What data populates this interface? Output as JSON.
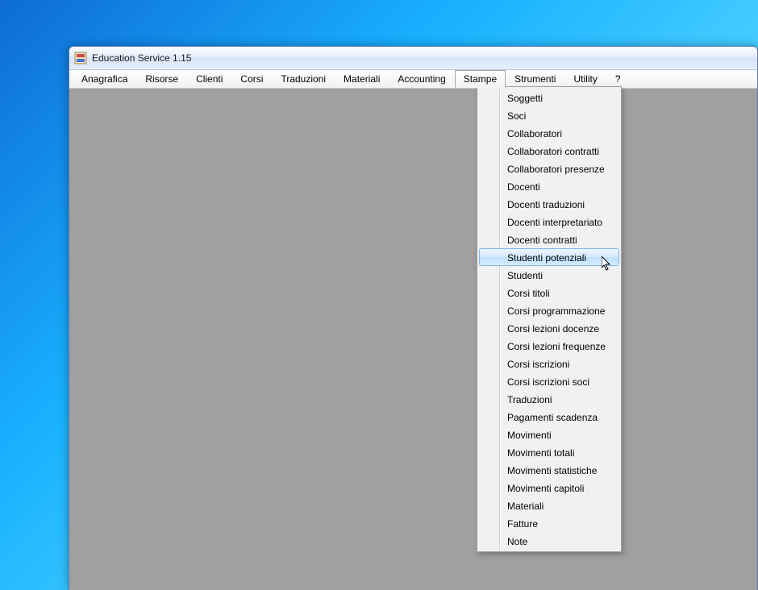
{
  "window": {
    "title": "Education Service 1.15"
  },
  "menubar": {
    "items": [
      {
        "label": "Anagrafica"
      },
      {
        "label": "Risorse"
      },
      {
        "label": "Clienti"
      },
      {
        "label": "Corsi"
      },
      {
        "label": "Traduzioni"
      },
      {
        "label": "Materiali"
      },
      {
        "label": "Accounting"
      },
      {
        "label": "Stampe"
      },
      {
        "label": "Strumenti"
      },
      {
        "label": "Utility"
      },
      {
        "label": "?"
      }
    ],
    "open_index": 7
  },
  "dropdown": {
    "highlight_index": 9,
    "items": [
      {
        "label": "Soggetti"
      },
      {
        "label": "Soci"
      },
      {
        "label": "Collaboratori"
      },
      {
        "label": "Collaboratori contratti"
      },
      {
        "label": "Collaboratori presenze"
      },
      {
        "label": "Docenti"
      },
      {
        "label": "Docenti traduzioni"
      },
      {
        "label": "Docenti interpretariato"
      },
      {
        "label": "Docenti contratti"
      },
      {
        "label": "Studenti potenziali"
      },
      {
        "label": "Studenti"
      },
      {
        "label": "Corsi titoli"
      },
      {
        "label": "Corsi programmazione"
      },
      {
        "label": "Corsi lezioni docenze"
      },
      {
        "label": "Corsi lezioni frequenze"
      },
      {
        "label": "Corsi iscrizioni"
      },
      {
        "label": "Corsi iscrizioni soci"
      },
      {
        "label": "Traduzioni"
      },
      {
        "label": "Pagamenti scadenza"
      },
      {
        "label": "Movimenti"
      },
      {
        "label": "Movimenti totali"
      },
      {
        "label": "Movimenti statistiche"
      },
      {
        "label": "Movimenti capitoli"
      },
      {
        "label": "Materiali"
      },
      {
        "label": "Fatture"
      },
      {
        "label": "Note"
      }
    ]
  }
}
